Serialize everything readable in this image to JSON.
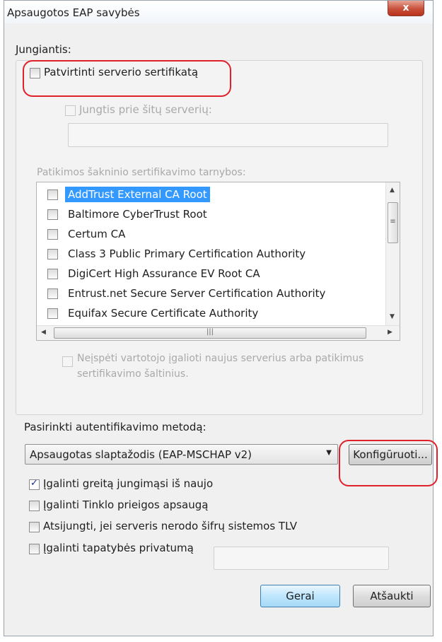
{
  "window": {
    "title": "Apsaugotos EAP savybės",
    "close_label": "x"
  },
  "connect": {
    "group_label": "Jungiantis:",
    "verify_cert": {
      "label": "Patvirtinti serverio sertifikatą",
      "checked": false
    },
    "connect_servers": {
      "label": "Jungtis prie šitų serverių:",
      "checked": false,
      "value": ""
    },
    "trusted_ca_label": "Patikimos šakninio sertifikavimo tarnybos:",
    "ca_list": [
      {
        "label": "AddTrust External CA Root",
        "selected": true
      },
      {
        "label": "Baltimore CyberTrust Root",
        "selected": false
      },
      {
        "label": "Certum CA",
        "selected": false
      },
      {
        "label": "Class 3 Public Primary Certification Authority",
        "selected": false
      },
      {
        "label": "DigiCert High Assurance EV Root CA",
        "selected": false
      },
      {
        "label": "Entrust.net Secure Server Certification Authority",
        "selected": false
      },
      {
        "label": "Equifax Secure Certificate Authority",
        "selected": false
      }
    ],
    "no_prompt": {
      "label_line1": "Neįspėti vartotojo įgalioti naujus serverius arba patikimus",
      "label_line2": "sertifikavimo šaltinius.",
      "checked": false
    }
  },
  "auth": {
    "method_label": "Pasirinkti autentifikavimo metodą:",
    "method_value": "Apsaugotas slaptažodis (EAP-MSCHAP v2)",
    "configure_label": "Konfigūruoti..."
  },
  "options": [
    {
      "label": "Įgalinti greitą jungimąsi iš naujo",
      "checked": true
    },
    {
      "label": "Įgalinti Tinklo prieigos apsaugą",
      "checked": false
    },
    {
      "label": "Atsijungti, jei serveris nerodo šifrų sistemos TLV",
      "checked": false
    },
    {
      "label": "Įgalinti tapatybės privatumą",
      "checked": false
    }
  ],
  "identity_value": "",
  "buttons": {
    "ok": "Gerai",
    "cancel": "Atšaukti"
  }
}
